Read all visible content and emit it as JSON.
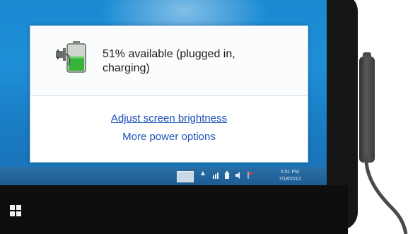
{
  "battery": {
    "status_text": "51% available (plugged in, charging)",
    "level_percent": 51
  },
  "links": {
    "brightness": "Adjust screen brightness",
    "power_options": "More power options"
  },
  "taskbar": {
    "time": "5:51 PM",
    "date": "7/18/2012",
    "tray_icons": [
      "keyboard-icon",
      "show-hidden-icons-arrow",
      "network-icon",
      "power-icon",
      "volume-icon",
      "flag-icon"
    ]
  },
  "colors": {
    "desktop": "#1f8fd8",
    "link": "#1a4fb5",
    "battery_fill": "#38b23a"
  }
}
